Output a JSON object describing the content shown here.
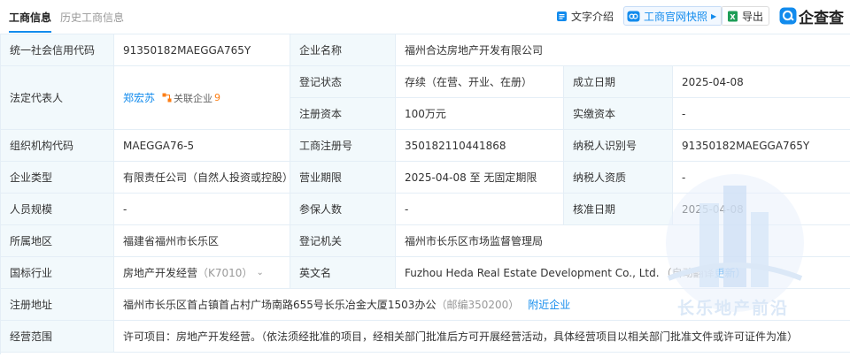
{
  "tabs": [
    {
      "label": "工商信息"
    },
    {
      "label": "历史工商信息"
    }
  ],
  "toolbar": {
    "intro_label": "文字介绍",
    "snapshot_label": "工商官网快照",
    "export_label": "导出",
    "logo_text": "企查查"
  },
  "icons": {
    "intro": "document-list-icon",
    "snapshot": "official-site-icon",
    "export": "excel-export-icon",
    "logo": "qcc-logo-icon",
    "related": "related-company-icon",
    "chevron": "chevron-down-icon"
  },
  "colors": {
    "accent": "#128bed",
    "label_bg": "#f2f9fc",
    "border": "#e4eef6",
    "count": "#fd7e14"
  },
  "info": {
    "credit_code_label": "统一社会信用代码",
    "credit_code": "91350182MAEGGA765Y",
    "company_name_label": "企业名称",
    "company_name": "福州合达房地产开发有限公司",
    "legal_rep_label": "法定代表人",
    "legal_rep": "郑宏苏",
    "related_label": "关联企业",
    "related_count": "9",
    "reg_status_label": "登记状态",
    "reg_status": "存续（在营、开业、在册）",
    "found_date_label": "成立日期",
    "found_date": "2025-04-08",
    "reg_capital_label": "注册资本",
    "reg_capital": "100万元",
    "paid_capital_label": "实缴资本",
    "paid_capital": "-",
    "org_code_label": "组织机构代码",
    "org_code": "MAEGGA76-5",
    "reg_no_label": "工商注册号",
    "reg_no": "350182110441868",
    "taxpayer_id_label": "纳税人识别号",
    "taxpayer_id": "91350182MAEGGA765Y",
    "company_type_label": "企业类型",
    "company_type": "有限责任公司（自然人投资或控股）",
    "biz_term_label": "营业期限",
    "biz_term": "2025-04-08 至 无固定期限",
    "taxpayer_qual_label": "纳税人资质",
    "taxpayer_qual": "-",
    "staff_size_label": "人员规模",
    "staff_size": "-",
    "insured_label": "参保人数",
    "insured": "-",
    "approve_date_label": "核准日期",
    "approve_date": "2025-04-08",
    "region_label": "所属地区",
    "region": "福建省福州市长乐区",
    "authority_label": "登记机关",
    "authority": "福州市长乐区市场监督管理局",
    "industry_label": "国标行业",
    "industry": "房地产开发经营",
    "industry_code": "（K7010）",
    "english_name_label": "英文名",
    "english_name": "Fuzhou Heda Real Estate Development Co., Ltd.",
    "auto_translate": "（自动翻译",
    "update_link": "更新）",
    "address_label": "注册地址",
    "address": "福州市长乐区首占镇首占村广场南路655号长乐冶金大厦1503办公",
    "postcode": "（邮编350200）",
    "nearby_link": "附近企业",
    "scope_label": "经营范围",
    "scope": "许可项目：房地产开发经营。（依法须经批准的项目，经相关部门批准后方可开展经营活动，具体经营项目以相关部门批准文件或许可证件为准）"
  },
  "watermark": {
    "text": "长乐地产前沿"
  }
}
